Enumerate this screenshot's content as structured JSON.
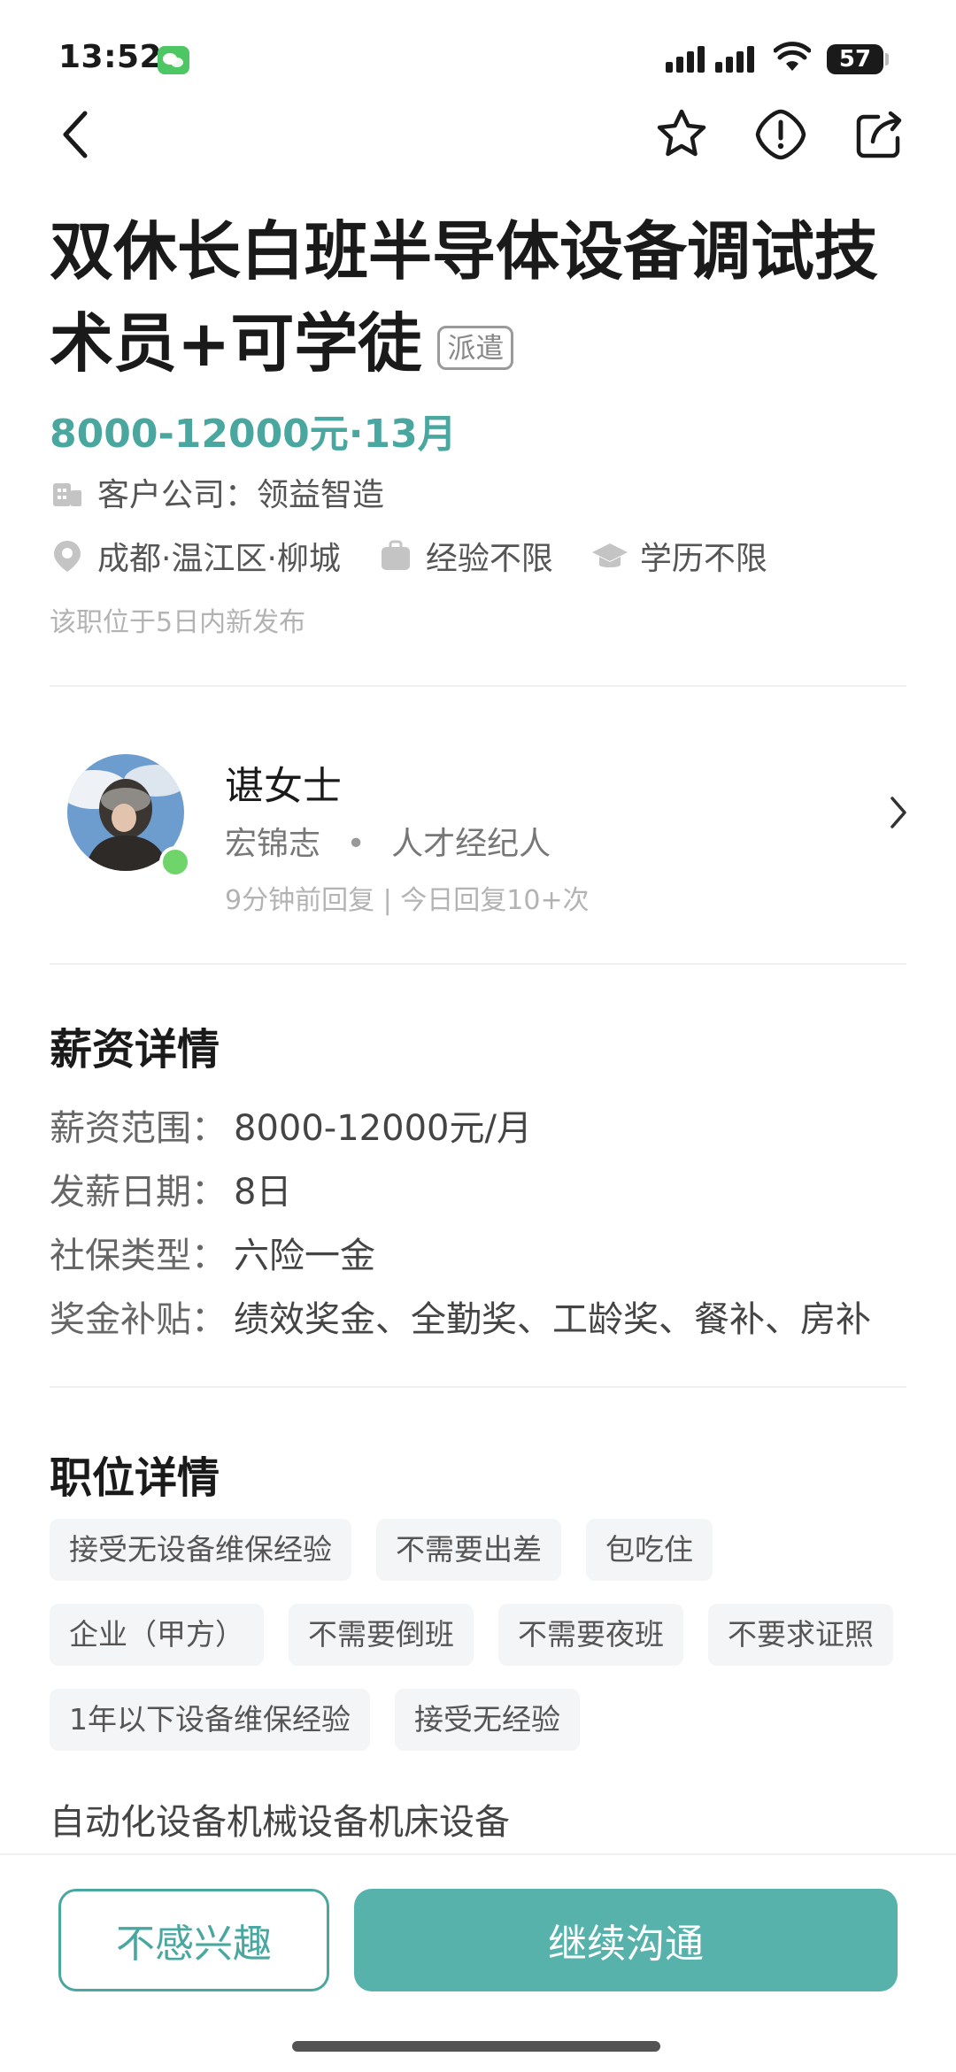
{
  "status_bar": {
    "time": "13:52",
    "battery": "57"
  },
  "job": {
    "title": "双休长白班半导体设备调试技术员+可学徒",
    "tag": "派遣",
    "salary": "8000-12000元·13月",
    "company": "客户公司：领益智造",
    "location": "成都·温江区·柳城",
    "experience": "经验不限",
    "education": "学历不限",
    "posted": "该职位于5日内新发布"
  },
  "recruiter": {
    "name": "谌女士",
    "company": "宏锦志",
    "role": "人才经纪人",
    "reply": "9分钟前回复 | 今日回复10+次"
  },
  "salary_detail": {
    "title": "薪资详情",
    "rows": [
      {
        "key": "薪资范围：",
        "value": "8000-12000元/月"
      },
      {
        "key": "发薪日期：",
        "value": "8日"
      },
      {
        "key": "社保类型：",
        "value": "六险一金"
      },
      {
        "key": "奖金补贴：",
        "value": "绩效奖金、全勤奖、工龄奖、餐补、房补"
      }
    ]
  },
  "job_detail": {
    "title": "职位详情",
    "tags": [
      "接受无设备维保经验",
      "不需要出差",
      "包吃住",
      "企业（甲方）",
      "不需要倒班",
      "不需要夜班",
      "不要求证照",
      "1年以下设备维保经验",
      "接受无经验"
    ],
    "industry": "自动化设备机械设备机床设备"
  },
  "actions": {
    "not_interested": "不感兴趣",
    "continue_chat": "继续沟通"
  },
  "colors": {
    "accent": "#4aa7a0",
    "button": "#57b2ac",
    "chip_bg": "#f4f5f6"
  },
  "icons": [
    "back-icon",
    "star-icon",
    "warning-icon",
    "share-icon",
    "building-icon",
    "location-icon",
    "briefcase-icon",
    "graduation-cap-icon",
    "chevron-right-icon"
  ]
}
